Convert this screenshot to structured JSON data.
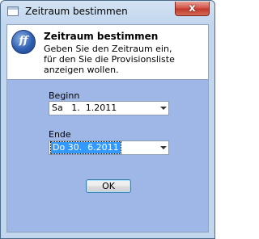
{
  "window": {
    "title": "Zeitraum bestimmen"
  },
  "titlebar": {
    "close_glyph": "x"
  },
  "header": {
    "title": "Zeitraum bestimmen",
    "description": "Geben Sie den Zeitraum ein,\nfür den Sie die Provisionsliste anzeigen wollen.",
    "logo_text": "ff"
  },
  "form": {
    "start_label": "Beginn",
    "start_value": "Sa   1.  1.2011",
    "end_label": "Ende",
    "end_value": "Do 30.  6.2011",
    "ok_label": "OK"
  },
  "icons": [
    "app-window-icon",
    "logo-icon",
    "close-icon",
    "dropdown-arrow-icon"
  ],
  "colors": {
    "client_background": "#9fb7e6",
    "selection": "#3399ff",
    "close_button": "#c13a2c"
  }
}
